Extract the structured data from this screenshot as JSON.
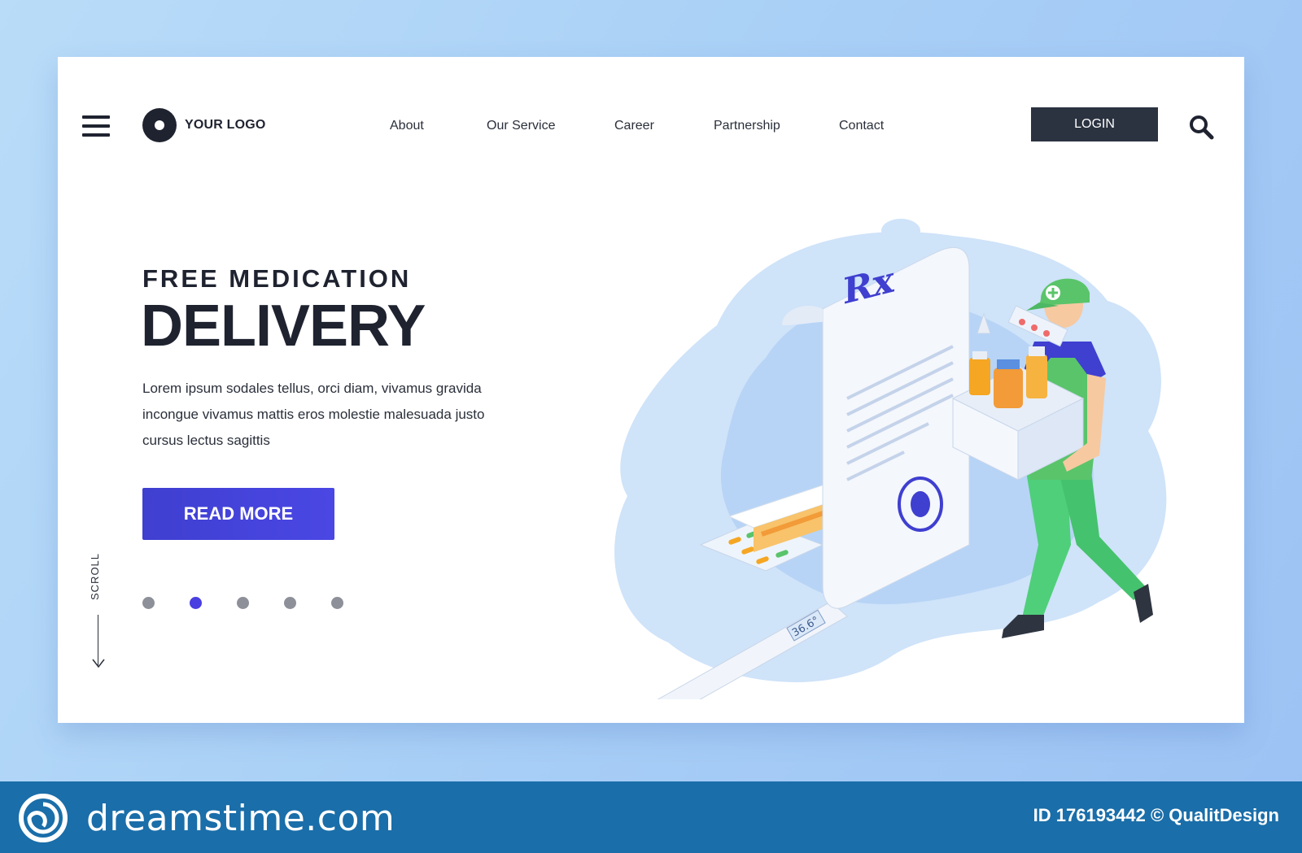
{
  "header": {
    "logo_text": "YOUR LOGO",
    "nav": [
      "About",
      "Our Service",
      "Career",
      "Partnership",
      "Contact"
    ],
    "login_label": "LOGIN"
  },
  "hero": {
    "overline": "FREE MEDICATION",
    "title": "DELIVERY",
    "description_lines": [
      "Lorem ipsum sodales tellus, orci diam, vivamus gravida",
      "incongue vivamus mattis eros molestie malesuada justo",
      "cursus lectus sagittis"
    ],
    "cta_label": "READ MORE",
    "scroll_label": "SCROLL",
    "pagination": {
      "count": 5,
      "active": 2
    }
  },
  "illustration": {
    "rx_text": "Rx",
    "thermometer_reading": "36.6°"
  },
  "footer": {
    "brand": "dreamstime.com",
    "meta": "ID 176193442 © QualitDesign"
  },
  "colors": {
    "accent": "#4a47e4",
    "dark": "#1f2330",
    "footer_bg": "#1a6ea9"
  }
}
